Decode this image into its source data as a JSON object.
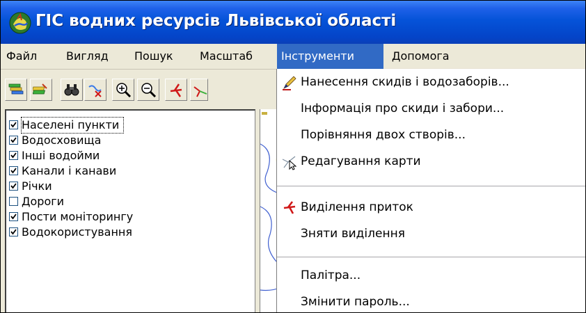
{
  "window": {
    "title": "ГІС водних ресурсів Львівської області",
    "title_bar_color": "#0553d8",
    "app_icon": "app-logo-icon"
  },
  "menubar": {
    "items": [
      {
        "label": "Файл"
      },
      {
        "label": "Вигляд"
      },
      {
        "label": "Пошук"
      },
      {
        "label": "Масштаб"
      },
      {
        "label": "Інструменти",
        "active": true
      },
      {
        "label": "Допомога"
      }
    ],
    "active_color": "#316ac5"
  },
  "toolbar": {
    "buttons": [
      {
        "icon": "layers-icon"
      },
      {
        "icon": "edit-layer-icon"
      },
      {
        "icon": "binoculars-search-icon"
      },
      {
        "icon": "clear-selection-icon"
      },
      {
        "icon": "zoom-in-icon"
      },
      {
        "icon": "zoom-out-icon"
      },
      {
        "icon": "select-tributary-icon"
      },
      {
        "icon": "tributary-tool-icon"
      }
    ]
  },
  "layers": {
    "items": [
      {
        "label": "Населені пункти",
        "checked": true,
        "focused": true
      },
      {
        "label": "Водосховища",
        "checked": true
      },
      {
        "label": "Інші водойми",
        "checked": true
      },
      {
        "label": "Канали і канави",
        "checked": true
      },
      {
        "label": "Річки",
        "checked": true
      },
      {
        "label": "Дороги",
        "checked": false
      },
      {
        "label": "Пости моніторингу",
        "checked": true
      },
      {
        "label": "Водокористування",
        "checked": true
      }
    ]
  },
  "dropdown": {
    "items": [
      {
        "label": "Нанесення скидів і водозаборів...",
        "icon": "pencil-icon"
      },
      {
        "label": "Інформація про скиди і забори..."
      },
      {
        "label": "Порівняння двох створів..."
      },
      {
        "label": "Редагування карти",
        "icon": "edit-map-cursor-icon"
      },
      {
        "separator": true
      },
      {
        "label": "Виділення приток",
        "icon": "tributary-select-icon"
      },
      {
        "label": "Зняти виділення"
      },
      {
        "separator": true
      },
      {
        "label": "Палітра..."
      },
      {
        "label": "Змінити пароль..."
      }
    ]
  }
}
